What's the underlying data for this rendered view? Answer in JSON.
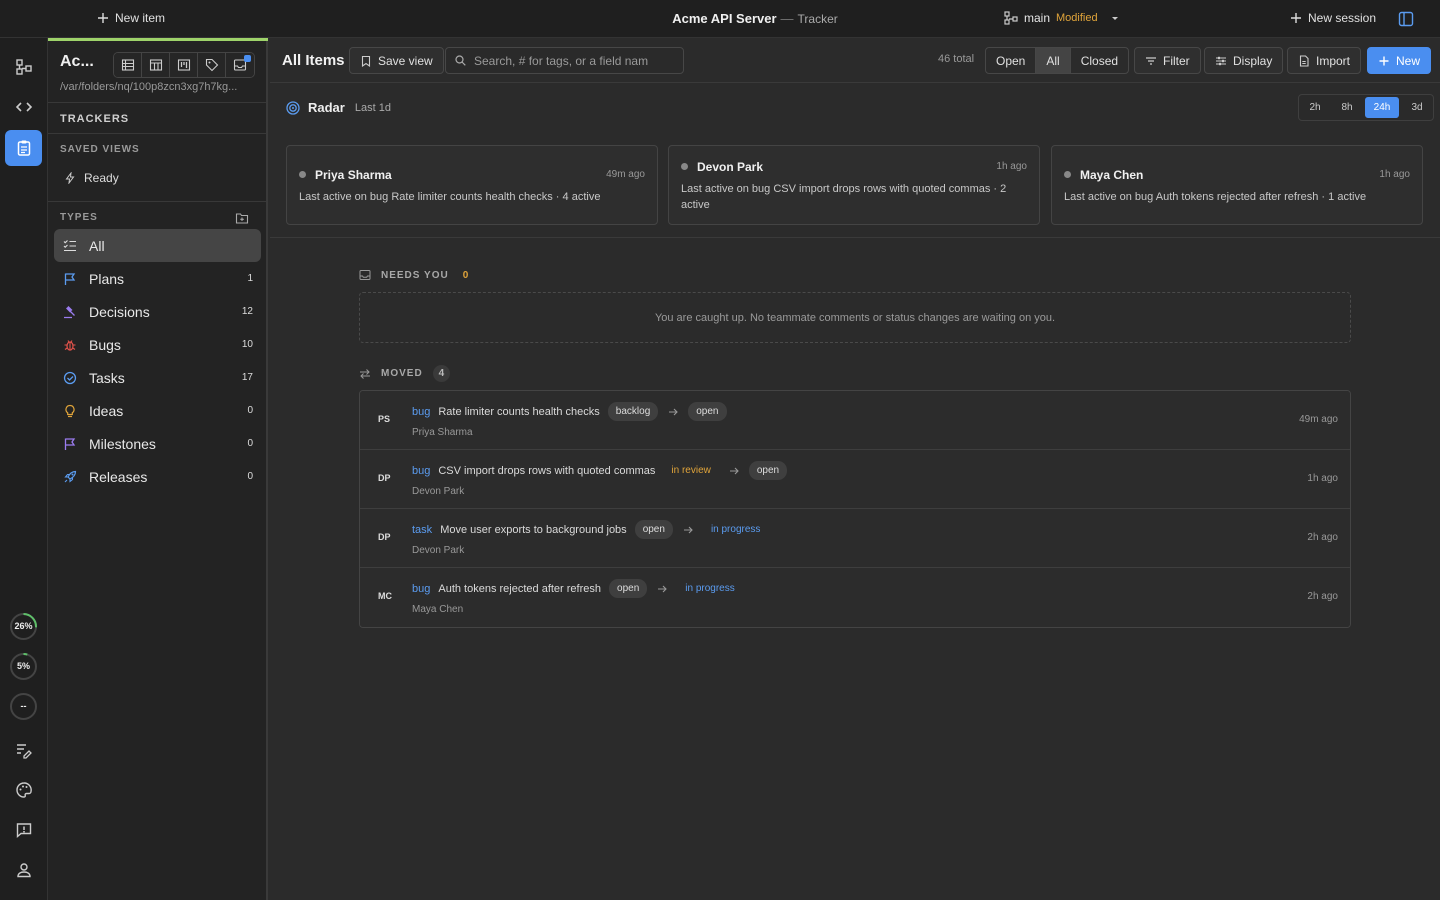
{
  "topbar": {
    "new_item": "New item",
    "app_title": "Acme API Server",
    "separator": "—",
    "app_subtitle": "Tracker",
    "branch": "main",
    "branch_status": "Modified",
    "new_session": "New session"
  },
  "rail": {
    "gauges": [
      "26%",
      "5%",
      "--"
    ]
  },
  "sidebar": {
    "project": "Ac...",
    "path": "/var/folders/nq/100p8zcn3xg7h7kg...",
    "trackers_heading": "TRACKERS",
    "saved_views_heading": "SAVED VIEWS",
    "saved_views": [
      "Ready"
    ],
    "types_heading": "TYPES",
    "types": [
      {
        "label": "All",
        "count": "",
        "icon": "checklist-icon",
        "color": "#d6d6d6"
      },
      {
        "label": "Plans",
        "count": "1",
        "icon": "flag-icon",
        "color": "#5b9cf0"
      },
      {
        "label": "Decisions",
        "count": "12",
        "icon": "gavel-icon",
        "color": "#9b7cf0"
      },
      {
        "label": "Bugs",
        "count": "10",
        "icon": "bug-icon",
        "color": "#e5534b"
      },
      {
        "label": "Tasks",
        "count": "17",
        "icon": "check-circle-icon",
        "color": "#5b9cf0"
      },
      {
        "label": "Ideas",
        "count": "0",
        "icon": "lightbulb-icon",
        "color": "#e0a43a"
      },
      {
        "label": "Milestones",
        "count": "0",
        "icon": "flag-icon",
        "color": "#9b7cf0"
      },
      {
        "label": "Releases",
        "count": "0",
        "icon": "rocket-icon",
        "color": "#5b9cf0"
      }
    ]
  },
  "header": {
    "title": "All Items",
    "save_view": "Save view",
    "search_placeholder": "Search, # for tags, or a field nam",
    "total": "46 total",
    "filters": [
      "Open",
      "All",
      "Closed"
    ],
    "filter_btn": "Filter",
    "display_btn": "Display",
    "import_btn": "Import",
    "new_btn": "New"
  },
  "radar": {
    "title": "Radar",
    "range": "Last 1d",
    "ranges": [
      "2h",
      "8h",
      "24h",
      "3d"
    ],
    "cards": [
      {
        "name": "Priya Sharma",
        "ago": "49m ago",
        "desc": "Last active on bug Rate limiter counts health checks · 4 active"
      },
      {
        "name": "Devon Park",
        "ago": "1h ago",
        "desc": "Last active on bug CSV import drops rows with quoted commas · 2 active"
      },
      {
        "name": "Maya Chen",
        "ago": "1h ago",
        "desc": "Last active on bug Auth tokens rejected after refresh · 1 active"
      }
    ]
  },
  "needs_you": {
    "label": "NEEDS YOU",
    "count": "0",
    "empty_text": "You are caught up. No teammate comments or status changes are waiting on you."
  },
  "moved": {
    "label": "MOVED",
    "count": "4",
    "rows": [
      {
        "initials": "PS",
        "type": "bug",
        "title": "Rate limiter counts health checks",
        "from": "backlog",
        "to": "open",
        "person": "Priya Sharma",
        "time": "49m ago"
      },
      {
        "initials": "DP",
        "type": "bug",
        "title": "CSV import drops rows with quoted commas",
        "from": "in review",
        "to": "open",
        "person": "Devon Park",
        "time": "1h ago"
      },
      {
        "initials": "DP",
        "type": "task",
        "title": "Move user exports to background jobs",
        "from": "open",
        "to": "in progress",
        "person": "Devon Park",
        "time": "2h ago"
      },
      {
        "initials": "MC",
        "type": "bug",
        "title": "Auth tokens rejected after refresh",
        "from": "open",
        "to": "in progress",
        "person": "Maya Chen",
        "time": "2h ago"
      }
    ]
  },
  "colors": {
    "accent": "#4a8ef0",
    "modified": "#e0a43a",
    "in_review": "#e0a43a",
    "in_progress": "#5b9cf0"
  }
}
